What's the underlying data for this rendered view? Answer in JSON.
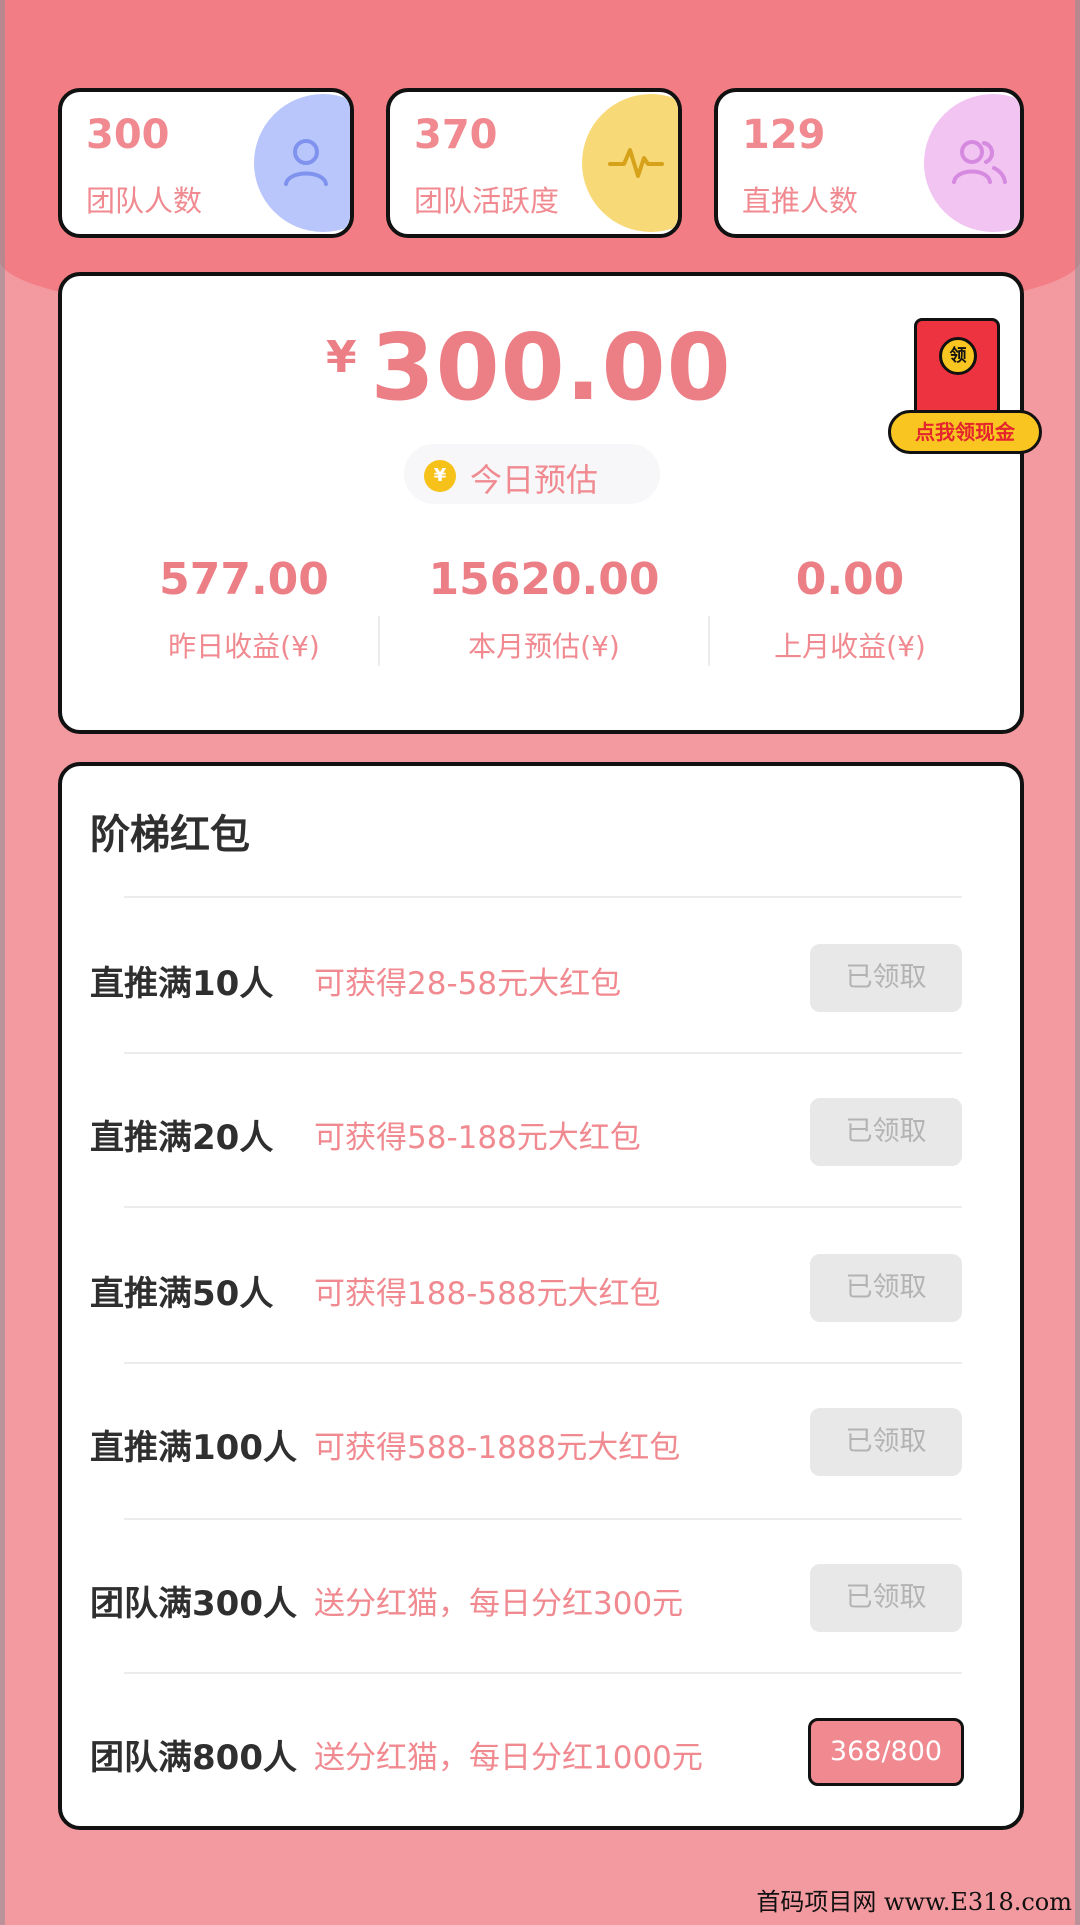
{
  "colors": {
    "accent": "#f08a90",
    "header_bg": "#f27d85",
    "page_bg": "#f39aa0"
  },
  "stats": [
    {
      "value": "300",
      "label": "团队人数",
      "icon": "person-icon",
      "circle_color": "#b8c6fb"
    },
    {
      "value": "370",
      "label": "团队活跃度",
      "icon": "activity-pulse-icon",
      "circle_color": "#f8d978"
    },
    {
      "value": "129",
      "label": "直推人数",
      "icon": "people-icon",
      "circle_color": "#f1c4f2"
    }
  ],
  "earnings": {
    "currency": "¥",
    "today_amount": "300.00",
    "today_label": "今日预估",
    "coin_icon": "coin-bag-icon",
    "red_packet": {
      "seal_text": "领",
      "button_label": "点我领现金"
    },
    "sub_stats": [
      {
        "value": "577.00",
        "label": "昨日收益(¥)"
      },
      {
        "value": "15620.00",
        "label": "本月预估(¥)"
      },
      {
        "value": "0.00",
        "label": "上月收益(¥)"
      }
    ]
  },
  "tiers": {
    "title": "阶梯红包",
    "rows": [
      {
        "condition": "直推满10人",
        "reward": "可获得28-58元大红包",
        "button": "已领取",
        "state": "claimed"
      },
      {
        "condition": "直推满20人",
        "reward": "可获得58-188元大红包",
        "button": "已领取",
        "state": "claimed"
      },
      {
        "condition": "直推满50人",
        "reward": "可获得188-588元大红包",
        "button": "已领取",
        "state": "claimed"
      },
      {
        "condition": "直推满100人",
        "reward": "可获得588-1888元大红包",
        "button": "已领取",
        "state": "claimed"
      },
      {
        "condition": "团队满300人",
        "reward": "送分红猫，每日分红300元",
        "button": "已领取",
        "state": "claimed"
      },
      {
        "condition": "团队满800人",
        "reward": "送分红猫，每日分红1000元",
        "button": "368/800",
        "state": "progress"
      }
    ]
  },
  "watermark": "首码项目网 www.E318.com"
}
